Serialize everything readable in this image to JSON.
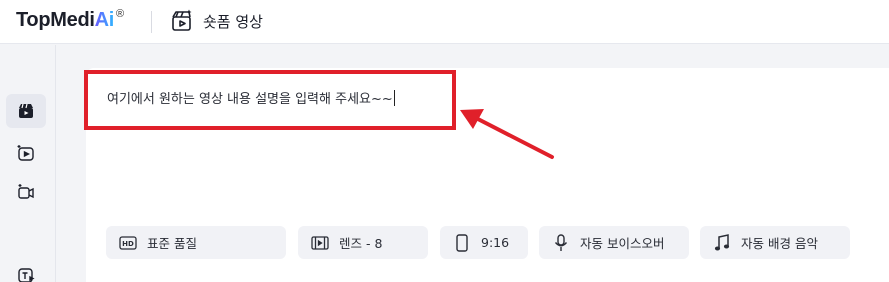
{
  "header": {
    "logo_text": "TopMedi",
    "logo_ai": "Ai",
    "logo_reg": "®",
    "page_title": "숏폼 영상"
  },
  "sidebar": {
    "items": [
      {
        "name": "clapper-icon",
        "active": true
      },
      {
        "name": "image-to-video-icon",
        "active": false
      },
      {
        "name": "video-add-icon",
        "active": false
      },
      {
        "name": "text-to-video-icon",
        "active": false
      }
    ]
  },
  "prompt": {
    "text": "여기에서 원하는 영상 내용 설명을 입력해 주세요~~"
  },
  "options": [
    {
      "icon": "hd-icon",
      "label": "표준 품질"
    },
    {
      "icon": "film-icon",
      "label": "렌즈 - 8"
    },
    {
      "icon": "phone-ratio-icon",
      "label": "9:16"
    },
    {
      "icon": "microphone-icon",
      "label": "자동 보이스오버"
    },
    {
      "icon": "music-note-icon",
      "label": "자동 배경 음악"
    }
  ],
  "colors": {
    "highlight": "#e0202a",
    "background": "#f3f4f7"
  }
}
